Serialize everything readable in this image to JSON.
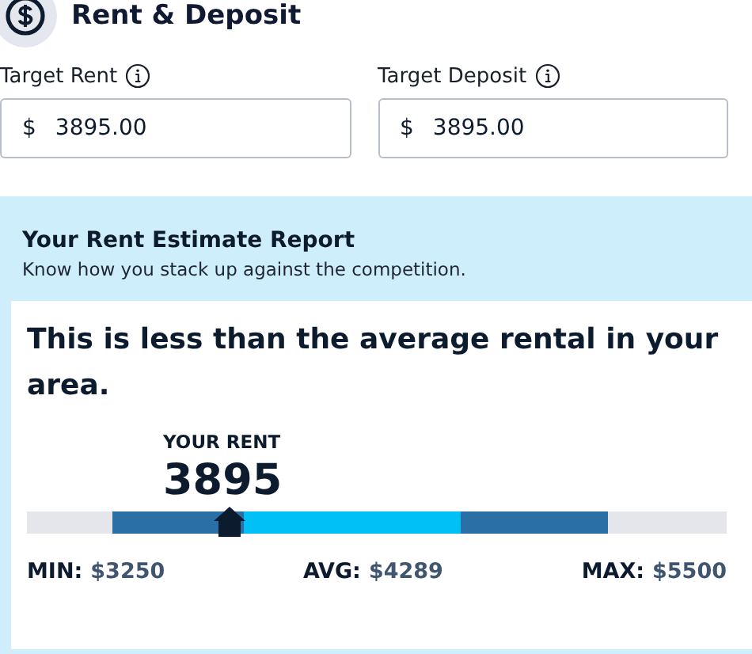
{
  "section": {
    "title": "Rent & Deposit"
  },
  "fields": [
    {
      "label": "Target Rent",
      "prefix": "$",
      "value": "3895.00"
    },
    {
      "label": "Target Deposit",
      "prefix": "$",
      "value": "3895.00"
    }
  ],
  "report": {
    "title": "Your Rent Estimate Report",
    "subtitle": "Know how you stack up against the competition.",
    "headline": "This is less than the average rental in your area.",
    "your_rent_label": "YOUR RENT",
    "your_rent": "3895",
    "marker": {
      "level": 0.29
    },
    "stats": [
      {
        "label": "MIN:",
        "value": "$3250"
      },
      {
        "label": "AVG:",
        "value": "$4289"
      },
      {
        "label": "MAX:",
        "value": "$5500"
      }
    ]
  }
}
